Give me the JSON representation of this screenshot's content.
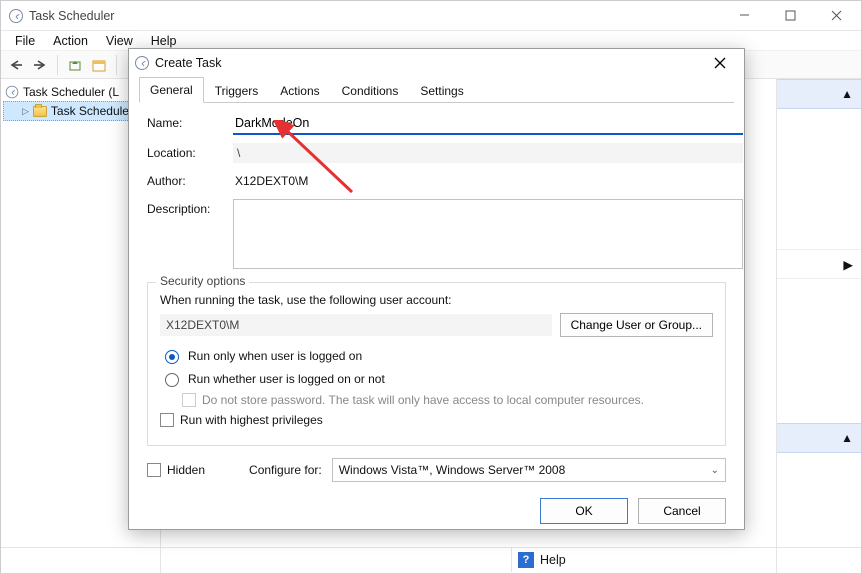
{
  "window": {
    "title": "Task Scheduler"
  },
  "menubar": {
    "items": [
      "File",
      "Action",
      "View",
      "Help"
    ]
  },
  "tree": {
    "root": "Task Scheduler (L",
    "child": "Task Schedule"
  },
  "statusbar": {
    "help": "Help"
  },
  "dialog": {
    "title": "Create Task",
    "tabs": [
      "General",
      "Triggers",
      "Actions",
      "Conditions",
      "Settings"
    ],
    "labels": {
      "name": "Name:",
      "location": "Location:",
      "author": "Author:",
      "description": "Description:"
    },
    "values": {
      "name": "DarkModeOn",
      "location": "\\",
      "author": "X12DEXT0\\M",
      "description": ""
    },
    "security": {
      "legend": "Security options",
      "prompt": "When running the task, use the following user account:",
      "account": "X12DEXT0\\M",
      "change_btn": "Change User or Group...",
      "radio_logged_on": "Run only when user is logged on",
      "radio_logged_or_not": "Run whether user is logged on or not",
      "no_store_pw": "Do not store password.  The task will only have access to local computer resources.",
      "highest_priv": "Run with highest privileges"
    },
    "hidden_label": "Hidden",
    "configure_for_label": "Configure for:",
    "configure_for_value": "Windows Vista™, Windows Server™ 2008",
    "buttons": {
      "ok": "OK",
      "cancel": "Cancel"
    }
  }
}
